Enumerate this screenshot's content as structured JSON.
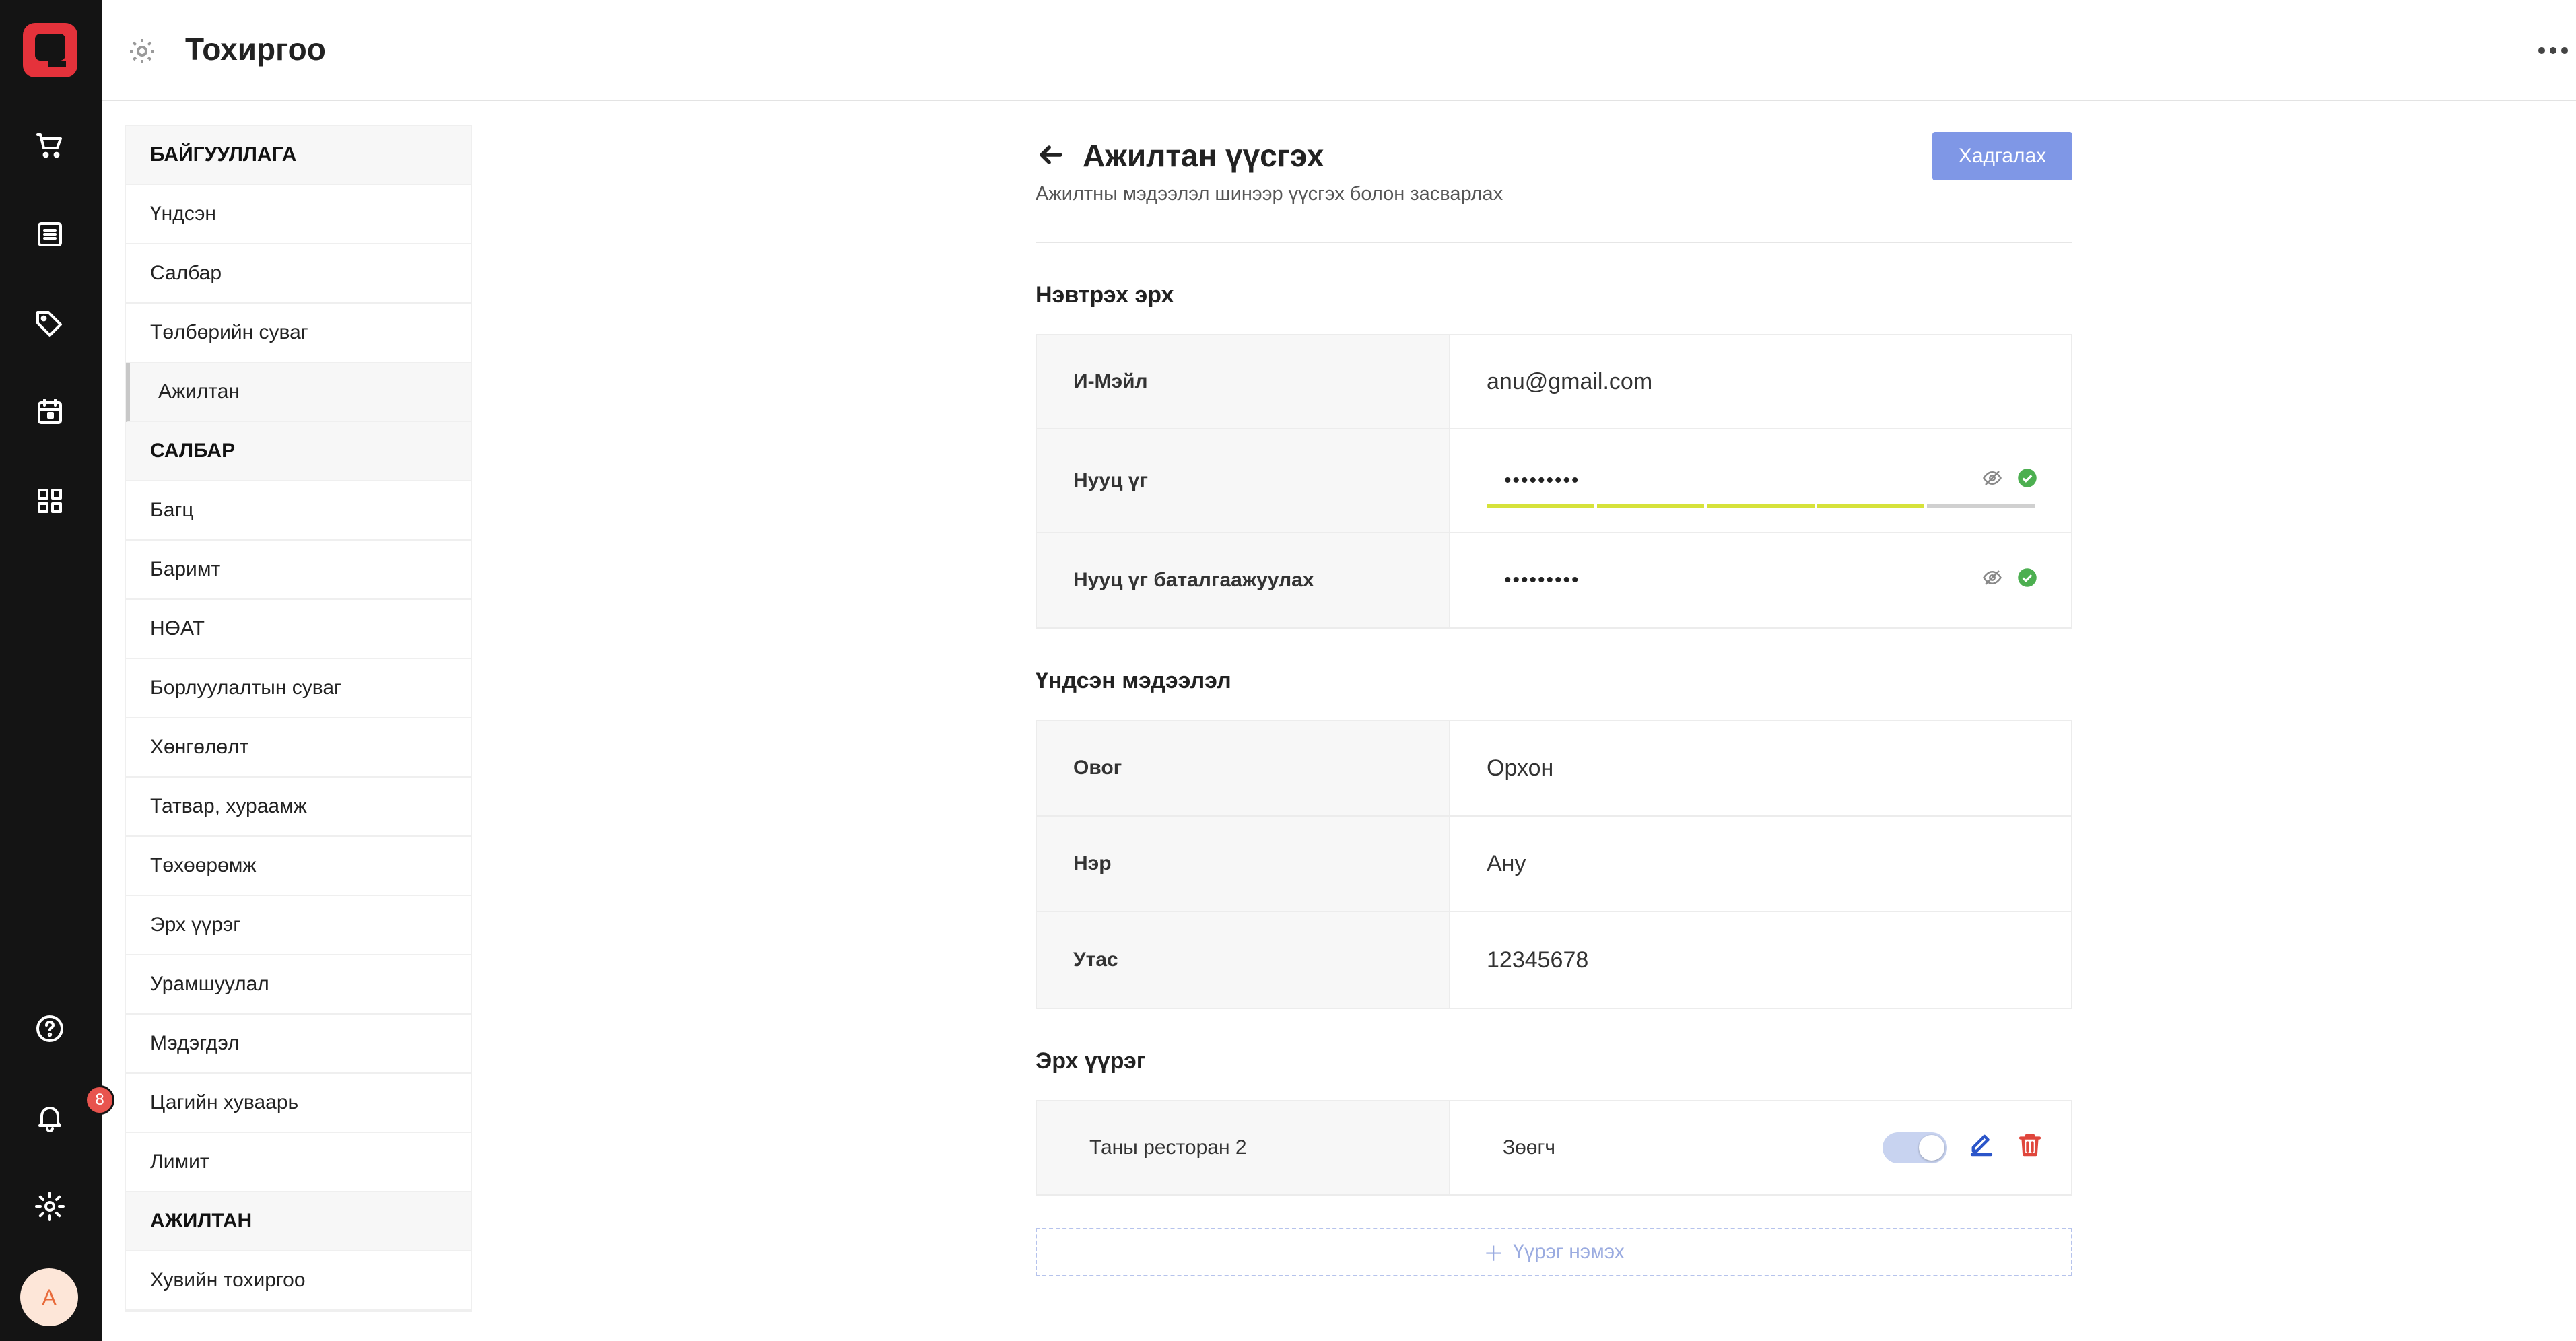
{
  "app": {
    "title": "Тохиргоо"
  },
  "rail": {
    "notification_count": "8",
    "avatar_initial": "A"
  },
  "colors": {
    "brand": "#e5323b",
    "primary_button": "#7f97e6",
    "badge": "#e8544e",
    "success": "#4caf50",
    "delete": "#e0463c",
    "edit": "#2b55c9"
  },
  "settings_menu": {
    "sections": [
      {
        "title": "БАЙГУУЛЛАГА",
        "items": [
          "Үндсэн",
          "Салбар",
          "Төлбөрийн суваг",
          "Ажилтан"
        ]
      },
      {
        "title": "САЛБАР",
        "items": [
          "Багц",
          "Баримт",
          "НӨАТ",
          "Борлуулалтын суваг",
          "Хөнгөлөлт",
          "Татвар, хураамж",
          "Төхөөрөмж",
          "Эрх үүрэг",
          "Урамшуулал",
          "Мэдэгдэл",
          "Цагийн хуваарь",
          "Лимит"
        ]
      },
      {
        "title": "АЖИЛТАН",
        "items": [
          "Хувийн тохиргоо"
        ]
      }
    ],
    "active_item": "Ажилтан"
  },
  "form": {
    "title": "Ажилтан үүсгэх",
    "subtitle": "Ажилтны мэдээлэл шинээр үүсгэх болон засварлах",
    "save_label": "Хадгалах",
    "login": {
      "title": "Нэвтрэх эрх",
      "email_label": "И-Мэйл",
      "email_value": "anu@gmail.com",
      "password_label": "Нууц үг",
      "password_value": "•••••••••",
      "password_strength": 0.8,
      "confirm_label": "Нууц үг баталгаажуулах",
      "confirm_value": "•••••••••"
    },
    "basic": {
      "title": "Үндсэн мэдээлэл",
      "surname_label": "Овог",
      "surname_value": "Орхон",
      "name_label": "Нэр",
      "name_value": "Ану",
      "phone_label": "Утас",
      "phone_value": "12345678"
    },
    "roles": {
      "title": "Эрх үүрэг",
      "items": [
        {
          "branch": "Таны ресторан 2",
          "role": "Зөөгч",
          "enabled": true
        }
      ],
      "add_label": "Үүрэг нэмэх"
    }
  }
}
